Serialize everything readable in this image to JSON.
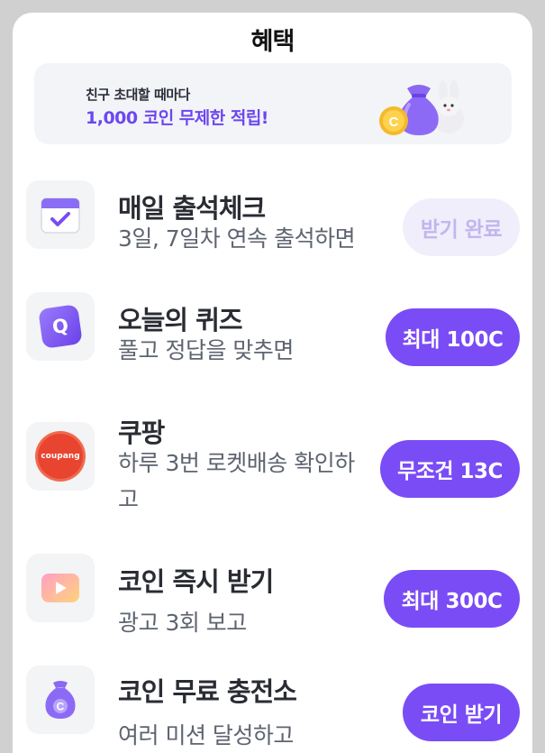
{
  "header": {
    "title": "혜택"
  },
  "banner": {
    "line1": "친구 초대할 때마다",
    "line2": "1,000 코인 무제한 적립!",
    "coin_letter": "C"
  },
  "colors": {
    "accent": "#7a4cf5",
    "accent_light": "#f0eefb",
    "banner_bg": "#f3f4f7"
  },
  "rewards": [
    {
      "icon": "calendar-check-icon",
      "title": "매일 출석체크",
      "subtitle": "3일, 7일차 연속 출석하면",
      "button": "받기 완료",
      "state": "completed"
    },
    {
      "icon": "quiz-q-icon",
      "title": "오늘의 퀴즈",
      "subtitle": "풀고 정답을 맞추면",
      "button": "최대 100C",
      "icon_text": "Q"
    },
    {
      "icon": "coupang-logo-icon",
      "title": "쿠팡",
      "subtitle": "하루 3번 로켓배송 확인하고",
      "button": "무조건 13C",
      "icon_text": "coupang"
    },
    {
      "icon": "video-play-icon",
      "title": "코인 즉시 받기",
      "subtitle": "광고 3회 보고",
      "button": "최대 300C"
    },
    {
      "icon": "coin-bag-icon",
      "title": "코인 무료 충전소",
      "subtitle": "여러 미션 달성하고",
      "button": "코인 받기",
      "icon_text": "C"
    }
  ]
}
